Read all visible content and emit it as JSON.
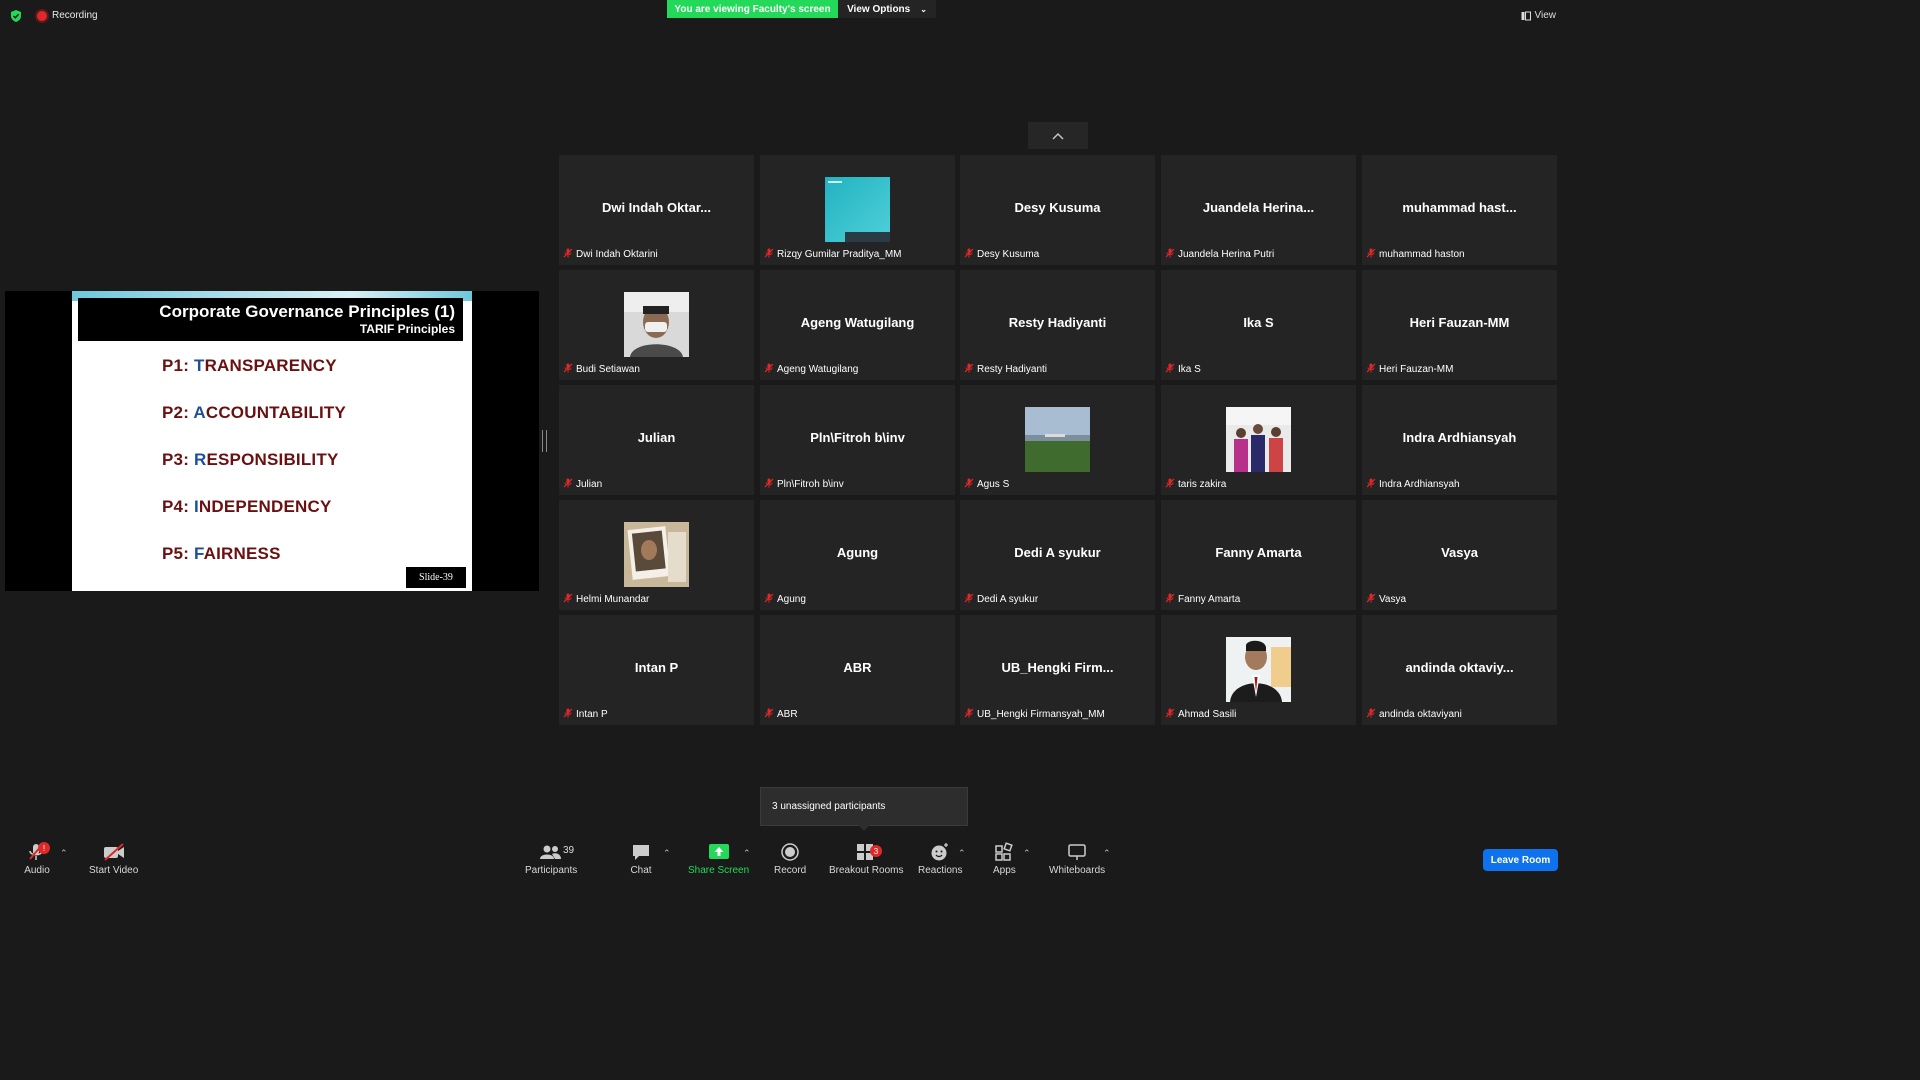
{
  "top_bar": {
    "recording_label": "Recording",
    "viewing_banner": "You are viewing Faculty's screen",
    "view_options_label": "View Options",
    "view_label": "View"
  },
  "slide": {
    "title": "Corporate Governance Principles (1)",
    "subtitle": "TARIF Principles",
    "principles": [
      {
        "prefix": "P1: ",
        "accent": "T",
        "rest": "RANSPARENCY"
      },
      {
        "prefix": "P2: ",
        "accent": "A",
        "rest": "CCOUNTABILITY"
      },
      {
        "prefix": "P3: ",
        "accent": "R",
        "rest": "ESPONSIBILITY"
      },
      {
        "prefix": "P4: ",
        "accent": "I",
        "rest": "NDEPENDENCY"
      },
      {
        "prefix": "P5: ",
        "accent": "F",
        "rest": "AIRNESS"
      }
    ],
    "slide_number": "Slide-39"
  },
  "participants": [
    {
      "display": "Dwi  Indah  Oktar...",
      "name": "Dwi Indah Oktarini"
    },
    {
      "display": "",
      "name": "Rizqy Gumilar Praditya_MM",
      "photo": "teal"
    },
    {
      "display": "Desy  Kusuma",
      "name": "Desy Kusuma"
    },
    {
      "display": "Juandela  Herina...",
      "name": "Juandela Herina Putri"
    },
    {
      "display": "muhammad  hast...",
      "name": "muhammad haston"
    },
    {
      "display": "",
      "name": "Budi Setiawan",
      "photo": "mask"
    },
    {
      "display": "Ageng  Watugilang",
      "name": "Ageng Watugilang"
    },
    {
      "display": "Resty  Hadiyanti",
      "name": "Resty Hadiyanti"
    },
    {
      "display": "Ika  S",
      "name": "Ika S"
    },
    {
      "display": "Heri  Fauzan-MM",
      "name": "Heri Fauzan-MM"
    },
    {
      "display": "Julian",
      "name": "Julian"
    },
    {
      "display": "Pln\\Fitroh  b\\inv",
      "name": "Pln\\Fitroh b\\inv"
    },
    {
      "display": "",
      "name": "Agus S",
      "photo": "landscape"
    },
    {
      "display": "",
      "name": "taris zakira",
      "photo": "group"
    },
    {
      "display": "Indra  Ardhiansyah",
      "name": "Indra Ardhiansyah"
    },
    {
      "display": "",
      "name": "Helmi Munandar",
      "photo": "portrait"
    },
    {
      "display": "Agung",
      "name": "Agung"
    },
    {
      "display": "Dedi  A  syukur",
      "name": "Dedi A syukur"
    },
    {
      "display": "Fanny  Amarta",
      "name": "Fanny Amarta"
    },
    {
      "display": "Vasya",
      "name": "Vasya"
    },
    {
      "display": "Intan  P",
      "name": "Intan P"
    },
    {
      "display": "ABR",
      "name": "ABR"
    },
    {
      "display": "UB_Hengki  Firm...",
      "name": "UB_Hengki Firmansyah_MM"
    },
    {
      "display": "",
      "name": "Ahmad Sasili",
      "photo": "suit"
    },
    {
      "display": "andinda  oktaviy...",
      "name": "andinda oktaviyani"
    }
  ],
  "tooltip": "3 unassigned participants",
  "toolbar": {
    "audio": "Audio",
    "audio_badge": "!",
    "start_video": "Start Video",
    "participants": "Participants",
    "participants_count": "39",
    "chat": "Chat",
    "share_screen": "Share Screen",
    "record": "Record",
    "breakout_rooms": "Breakout Rooms",
    "breakout_badge": "3",
    "reactions": "Reactions",
    "apps": "Apps",
    "whiteboards": "Whiteboards",
    "leave": "Leave Room"
  },
  "colors": {
    "background": "#1a1a1a",
    "tile": "#242424",
    "banner_green": "#23d959",
    "leave_blue": "#0e72ed",
    "muted_red": "#e02828"
  }
}
